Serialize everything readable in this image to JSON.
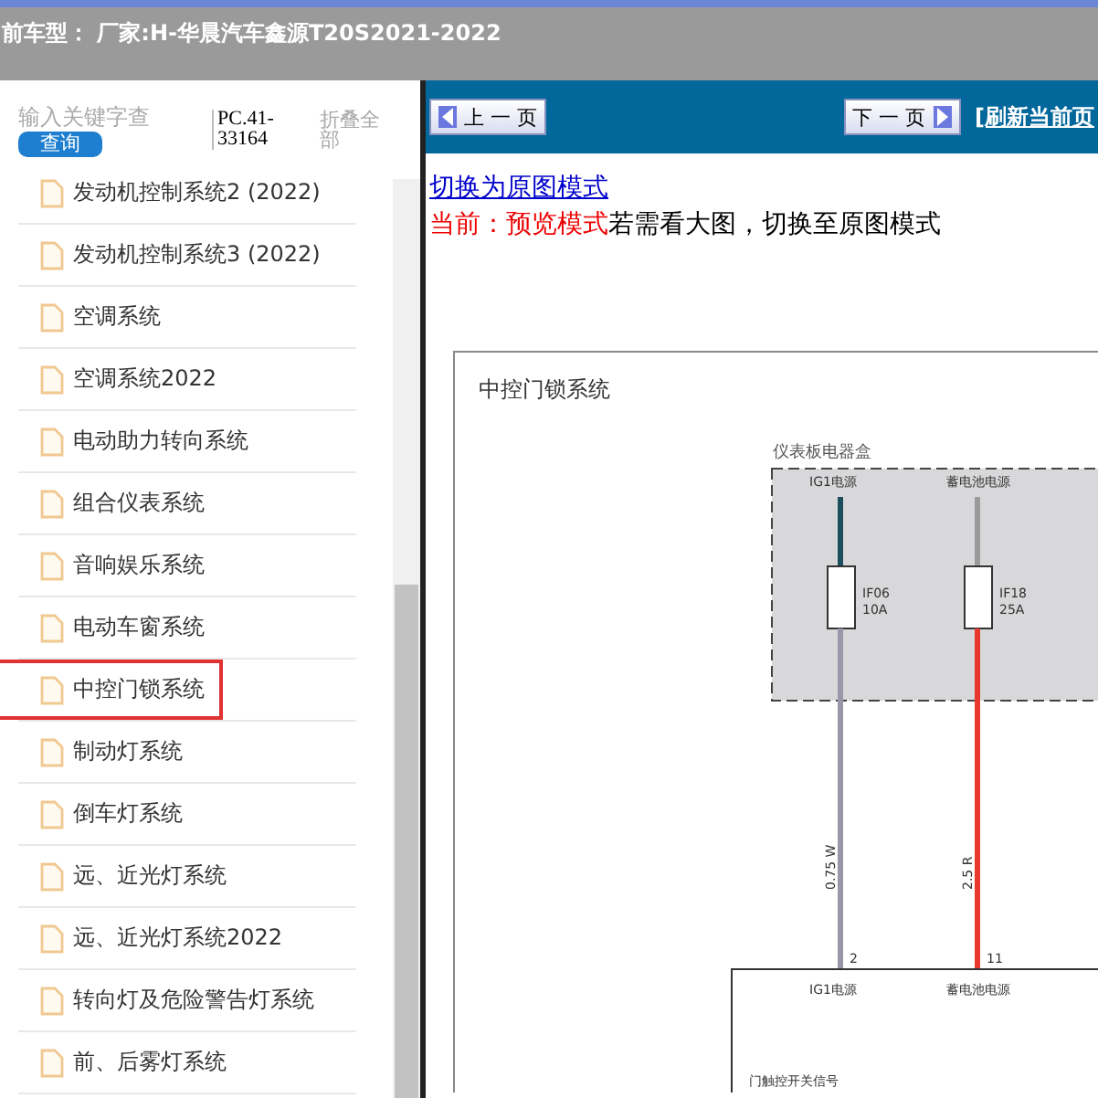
{
  "header": {
    "title": "前车型：  厂家:H-华晨汽车鑫源T20S2021-2022"
  },
  "sidebar": {
    "search": {
      "placeholder": "输入关键字查"
    },
    "search_button": "查询",
    "code": "PC.41-33164",
    "collapse": "折叠全部",
    "items": [
      {
        "label": "发动机控制系统2 (2022)",
        "highlighted": false
      },
      {
        "label": "发动机控制系统3 (2022)",
        "highlighted": false
      },
      {
        "label": "空调系统",
        "highlighted": false
      },
      {
        "label": "空调系统2022",
        "highlighted": false
      },
      {
        "label": "电动助力转向系统",
        "highlighted": false
      },
      {
        "label": "组合仪表系统",
        "highlighted": false
      },
      {
        "label": "音响娱乐系统",
        "highlighted": false
      },
      {
        "label": "电动车窗系统",
        "highlighted": false
      },
      {
        "label": "中控门锁系统",
        "highlighted": true
      },
      {
        "label": "制动灯系统",
        "highlighted": false
      },
      {
        "label": "倒车灯系统",
        "highlighted": false
      },
      {
        "label": "远、近光灯系统",
        "highlighted": false
      },
      {
        "label": "远、近光灯系统2022",
        "highlighted": false
      },
      {
        "label": "转向灯及危险警告灯系统",
        "highlighted": false
      },
      {
        "label": "前、后雾灯系统",
        "highlighted": false
      }
    ]
  },
  "toolbar": {
    "prev": "上 一 页",
    "next": "下 一 页",
    "refresh": "[刷新当前页"
  },
  "mode": {
    "switch_link": "切换为原图模式",
    "current_label": "当前：预览模式",
    "hint": "若需看大图，切换至原图模式"
  },
  "diagram": {
    "title": "中控门锁系统",
    "box_label": "仪表板电器盒",
    "sources": [
      {
        "label": "IG1电源",
        "fuse": "IF06",
        "rating": "10A",
        "wire": "0.75 W",
        "pin": "2",
        "pin_label": "IG1电源",
        "color": "#9a98a8"
      },
      {
        "label": "蓄电池电源",
        "fuse": "IF18",
        "rating": "25A",
        "wire": "2.5 R",
        "pin": "11",
        "pin_label": "蓄电池电源",
        "color": "#e8372c"
      }
    ],
    "signal": "门触控开关信号"
  }
}
